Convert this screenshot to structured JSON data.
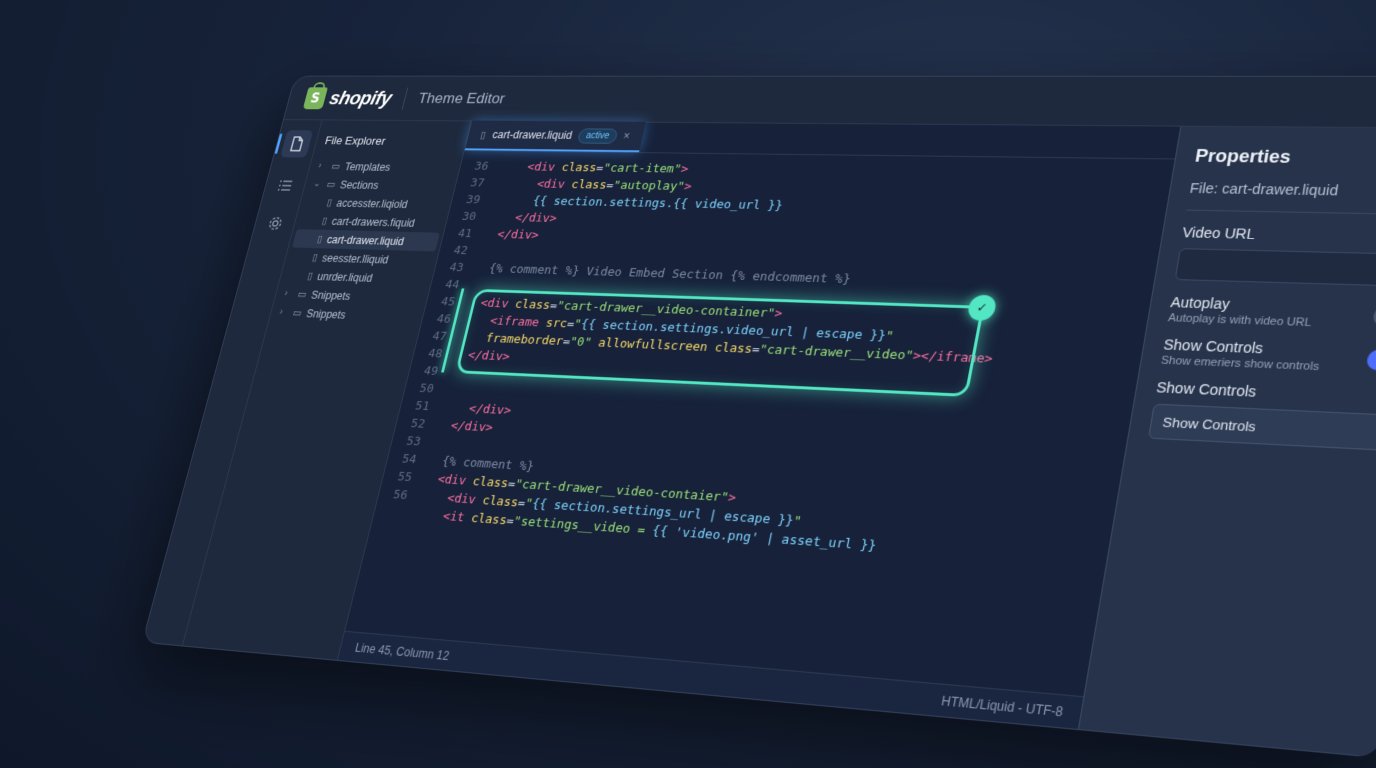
{
  "brand": {
    "name": "shopify",
    "icon": "shopify-bag-icon"
  },
  "app_title": "Theme Editor",
  "explorer": {
    "title": "File Explorer",
    "items": [
      {
        "type": "folder",
        "label": "Templates",
        "expanded": false
      },
      {
        "type": "folder",
        "label": "Sections",
        "expanded": true
      },
      {
        "type": "file",
        "label": "accesster.liqiold"
      },
      {
        "type": "file",
        "label": "cart-drawers.fiquid"
      },
      {
        "type": "file",
        "label": "cart-drawer.liquid",
        "selected": true
      },
      {
        "type": "file",
        "label": "seesster.lliquid"
      },
      {
        "type": "file",
        "label": "unrder.liquid"
      },
      {
        "type": "folder",
        "label": "Snippets",
        "expanded": false
      },
      {
        "type": "folder",
        "label": "Snippets",
        "expanded": false
      }
    ]
  },
  "tab": {
    "label": "cart-drawer.liquid",
    "badge": "active",
    "close": "×"
  },
  "code_lines": [
    {
      "n": "36",
      "html": "    <span class='tg'>&lt;div</span> <span class='at'>class</span>=<span class='st'>\"cart-item\"</span><span class='tg'>&gt;</span>"
    },
    {
      "n": "37",
      "html": "      <span class='tg'>&lt;div</span> <span class='at'>class</span>=<span class='st'>\"autoplay\"</span><span class='tg'>&gt;</span>"
    },
    {
      "n": "39",
      "html": "      <span class='lq'>{{ section.settings.{{ video_url }}</span>"
    },
    {
      "n": "30",
      "html": "    <span class='tg'>&lt;/div&gt;</span>"
    },
    {
      "n": "41",
      "html": "  <span class='tg'>&lt;/div&gt;</span>"
    },
    {
      "n": "42",
      "html": ""
    },
    {
      "n": "43",
      "html": "  <span class='cm'>{% comment %} Video Embed Section {% endcomment %}</span>"
    },
    {
      "n": "44",
      "html": ""
    },
    {
      "n": "45",
      "html": "  <span class='tg'>&lt;div</span> <span class='at'>class</span>=<span class='st'>\"cart-drawer__video-container\"</span><span class='tg'>&gt;</span>"
    },
    {
      "n": "46",
      "html": "    <span class='tg'>&lt;iframe</span> <span class='at'>src</span>=<span class='st'>\"</span><span class='lq'>{{ section.settings.video_url | escape }}</span><span class='st'>\"</span>"
    },
    {
      "n": "47",
      "html": "    <span class='at'>frameborder</span>=<span class='st'>\"0\"</span> <span class='at'>allowfullscreen</span> <span class='at'>class</span>=<span class='st'>\"cart-drawer__video\"</span><span class='tg'>&gt;&lt;/iframe&gt;</span>"
    },
    {
      "n": "48",
      "html": "  <span class='tg'>&lt;/div&gt;</span>"
    },
    {
      "n": "49",
      "html": ""
    },
    {
      "n": "50",
      "html": ""
    },
    {
      "n": "51",
      "html": "    <span class='tg'>&lt;/div&gt;</span>"
    },
    {
      "n": "52",
      "html": "  <span class='tg'>&lt;/div&gt;</span>"
    },
    {
      "n": "53",
      "html": ""
    },
    {
      "n": "54",
      "html": "  <span class='cm'>{% comment %}</span>"
    },
    {
      "n": "55",
      "html": "  <span class='tg'>&lt;div</span> <span class='at'>class</span>=<span class='st'>\"cart-drawer__video-contaier\"</span><span class='tg'>&gt;</span>"
    },
    {
      "n": "56",
      "html": "    <span class='tg'>&lt;div</span> <span class='at'>class</span>=<span class='st'>\"</span><span class='lq'>{{ section.settings_url | escape }}</span><span class='st'>\"</span>"
    },
    {
      "n": "",
      "html": "    <span class='tg'>&lt;it</span> <span class='at'>class</span>=<span class='st'>\"settings__video = </span><span class='lq'>{{ 'video.png' | asset_url }}</span>"
    }
  ],
  "status": {
    "position": "Line 45, Column 12",
    "language": "HTML/Liquid - UTF-8"
  },
  "properties": {
    "title": "Properties",
    "file_label": "File: cart-drawer.liquid",
    "video_url_label": "Video URL",
    "video_url_value": "",
    "autoplay": {
      "label": "Autoplay",
      "hint": "Autoplay is with video URL",
      "on": false
    },
    "show_controls": {
      "label": "Show Controls",
      "hint": "Show emeriers show controls",
      "on": true
    },
    "show_controls_select_label": "Show Controls",
    "show_controls_select_value": "Show Controls"
  },
  "colors": {
    "accent": "#52e6c3",
    "tab_glow": "#4da3ff",
    "toggle_on": "#4f6dfb",
    "brand": "#7ab55c"
  }
}
